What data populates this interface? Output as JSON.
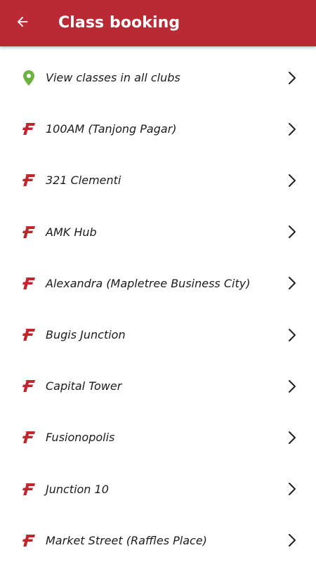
{
  "header": {
    "title": "Class booking",
    "back_icon": "arrow-left-icon",
    "background_color": "#b92a34"
  },
  "list": {
    "items": [
      {
        "label": "View classes in all clubs",
        "icon": "location-pin-icon",
        "icon_color": "#6db33f"
      },
      {
        "label": "100AM (Tanjong Pagar)",
        "icon": "fitness-first-logo-icon",
        "icon_color": "#c0272d"
      },
      {
        "label": "321 Clementi",
        "icon": "fitness-first-logo-icon",
        "icon_color": "#c0272d"
      },
      {
        "label": "AMK Hub",
        "icon": "fitness-first-logo-icon",
        "icon_color": "#c0272d"
      },
      {
        "label": "Alexandra (Mapletree Business City)",
        "icon": "fitness-first-logo-icon",
        "icon_color": "#c0272d"
      },
      {
        "label": "Bugis Junction",
        "icon": "fitness-first-logo-icon",
        "icon_color": "#c0272d"
      },
      {
        "label": "Capital Tower",
        "icon": "fitness-first-logo-icon",
        "icon_color": "#c0272d"
      },
      {
        "label": "Fusionopolis",
        "icon": "fitness-first-logo-icon",
        "icon_color": "#c0272d"
      },
      {
        "label": "Junction 10",
        "icon": "fitness-first-logo-icon",
        "icon_color": "#c0272d"
      },
      {
        "label": "Market Street (Raffles Place)",
        "icon": "fitness-first-logo-icon",
        "icon_color": "#c0272d"
      }
    ],
    "chevron_icon": "chevron-right-icon"
  }
}
